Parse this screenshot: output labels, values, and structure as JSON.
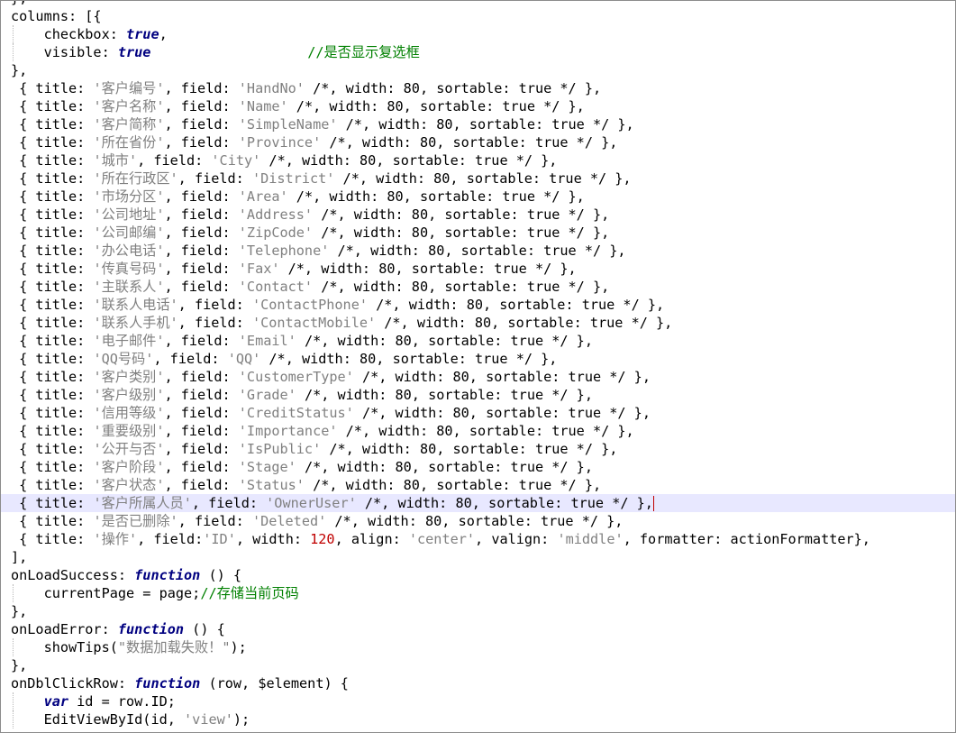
{
  "editor": {
    "lines": [
      {
        "indent": false,
        "hl": false,
        "tokens": [
          {
            "t": "},",
            "c": "pl"
          }
        ]
      },
      {
        "indent": false,
        "hl": false,
        "tokens": [
          {
            "t": "columns: [{",
            "c": "pl"
          }
        ]
      },
      {
        "indent": true,
        "hl": false,
        "tokens": [
          {
            "t": "    checkbox: ",
            "c": "pl"
          },
          {
            "t": "true",
            "c": "kw"
          },
          {
            "t": ",",
            "c": "pl"
          }
        ]
      },
      {
        "indent": true,
        "hl": false,
        "tokens": [
          {
            "t": "    visible: ",
            "c": "pl"
          },
          {
            "t": "true",
            "c": "kw"
          },
          {
            "t": "                   ",
            "c": "pl"
          },
          {
            "t": "//是否显示复选框",
            "c": "cmt"
          }
        ]
      },
      {
        "indent": false,
        "hl": false,
        "tokens": [
          {
            "t": "},",
            "c": "pl"
          }
        ]
      },
      {
        "indent": false,
        "hl": false,
        "tokens": [
          {
            "t": " { title: ",
            "c": "pl"
          },
          {
            "t": "'客户编号'",
            "c": "str"
          },
          {
            "t": ", field: ",
            "c": "pl"
          },
          {
            "t": "'HandNo'",
            "c": "str"
          },
          {
            "t": " /*, width: 80, sortable: true */ },",
            "c": "pl"
          }
        ]
      },
      {
        "indent": false,
        "hl": false,
        "tokens": [
          {
            "t": " { title: ",
            "c": "pl"
          },
          {
            "t": "'客户名称'",
            "c": "str"
          },
          {
            "t": ", field: ",
            "c": "pl"
          },
          {
            "t": "'Name'",
            "c": "str"
          },
          {
            "t": " /*, width: 80, sortable: true */ },",
            "c": "pl"
          }
        ]
      },
      {
        "indent": false,
        "hl": false,
        "tokens": [
          {
            "t": " { title: ",
            "c": "pl"
          },
          {
            "t": "'客户简称'",
            "c": "str"
          },
          {
            "t": ", field: ",
            "c": "pl"
          },
          {
            "t": "'SimpleName'",
            "c": "str"
          },
          {
            "t": " /*, width: 80, sortable: true */ },",
            "c": "pl"
          }
        ]
      },
      {
        "indent": false,
        "hl": false,
        "tokens": [
          {
            "t": " { title: ",
            "c": "pl"
          },
          {
            "t": "'所在省份'",
            "c": "str"
          },
          {
            "t": ", field: ",
            "c": "pl"
          },
          {
            "t": "'Province'",
            "c": "str"
          },
          {
            "t": " /*, width: 80, sortable: true */ },",
            "c": "pl"
          }
        ]
      },
      {
        "indent": false,
        "hl": false,
        "tokens": [
          {
            "t": " { title: ",
            "c": "pl"
          },
          {
            "t": "'城市'",
            "c": "str"
          },
          {
            "t": ", field: ",
            "c": "pl"
          },
          {
            "t": "'City'",
            "c": "str"
          },
          {
            "t": " /*, width: 80, sortable: true */ },",
            "c": "pl"
          }
        ]
      },
      {
        "indent": false,
        "hl": false,
        "tokens": [
          {
            "t": " { title: ",
            "c": "pl"
          },
          {
            "t": "'所在行政区'",
            "c": "str"
          },
          {
            "t": ", field: ",
            "c": "pl"
          },
          {
            "t": "'District'",
            "c": "str"
          },
          {
            "t": " /*, width: 80, sortable: true */ },",
            "c": "pl"
          }
        ]
      },
      {
        "indent": false,
        "hl": false,
        "tokens": [
          {
            "t": " { title: ",
            "c": "pl"
          },
          {
            "t": "'市场分区'",
            "c": "str"
          },
          {
            "t": ", field: ",
            "c": "pl"
          },
          {
            "t": "'Area'",
            "c": "str"
          },
          {
            "t": " /*, width: 80, sortable: true */ },",
            "c": "pl"
          }
        ]
      },
      {
        "indent": false,
        "hl": false,
        "tokens": [
          {
            "t": " { title: ",
            "c": "pl"
          },
          {
            "t": "'公司地址'",
            "c": "str"
          },
          {
            "t": ", field: ",
            "c": "pl"
          },
          {
            "t": "'Address'",
            "c": "str"
          },
          {
            "t": " /*, width: 80, sortable: true */ },",
            "c": "pl"
          }
        ]
      },
      {
        "indent": false,
        "hl": false,
        "tokens": [
          {
            "t": " { title: ",
            "c": "pl"
          },
          {
            "t": "'公司邮编'",
            "c": "str"
          },
          {
            "t": ", field: ",
            "c": "pl"
          },
          {
            "t": "'ZipCode'",
            "c": "str"
          },
          {
            "t": " /*, width: 80, sortable: true */ },",
            "c": "pl"
          }
        ]
      },
      {
        "indent": false,
        "hl": false,
        "tokens": [
          {
            "t": " { title: ",
            "c": "pl"
          },
          {
            "t": "'办公电话'",
            "c": "str"
          },
          {
            "t": ", field: ",
            "c": "pl"
          },
          {
            "t": "'Telephone'",
            "c": "str"
          },
          {
            "t": " /*, width: 80, sortable: true */ },",
            "c": "pl"
          }
        ]
      },
      {
        "indent": false,
        "hl": false,
        "tokens": [
          {
            "t": " { title: ",
            "c": "pl"
          },
          {
            "t": "'传真号码'",
            "c": "str"
          },
          {
            "t": ", field: ",
            "c": "pl"
          },
          {
            "t": "'Fax'",
            "c": "str"
          },
          {
            "t": " /*, width: 80, sortable: true */ },",
            "c": "pl"
          }
        ]
      },
      {
        "indent": false,
        "hl": false,
        "tokens": [
          {
            "t": " { title: ",
            "c": "pl"
          },
          {
            "t": "'主联系人'",
            "c": "str"
          },
          {
            "t": ", field: ",
            "c": "pl"
          },
          {
            "t": "'Contact'",
            "c": "str"
          },
          {
            "t": " /*, width: 80, sortable: true */ },",
            "c": "pl"
          }
        ]
      },
      {
        "indent": false,
        "hl": false,
        "tokens": [
          {
            "t": " { title: ",
            "c": "pl"
          },
          {
            "t": "'联系人电话'",
            "c": "str"
          },
          {
            "t": ", field: ",
            "c": "pl"
          },
          {
            "t": "'ContactPhone'",
            "c": "str"
          },
          {
            "t": " /*, width: 80, sortable: true */ },",
            "c": "pl"
          }
        ]
      },
      {
        "indent": false,
        "hl": false,
        "tokens": [
          {
            "t": " { title: ",
            "c": "pl"
          },
          {
            "t": "'联系人手机'",
            "c": "str"
          },
          {
            "t": ", field: ",
            "c": "pl"
          },
          {
            "t": "'ContactMobile'",
            "c": "str"
          },
          {
            "t": " /*, width: 80, sortable: true */ },",
            "c": "pl"
          }
        ]
      },
      {
        "indent": false,
        "hl": false,
        "tokens": [
          {
            "t": " { title: ",
            "c": "pl"
          },
          {
            "t": "'电子邮件'",
            "c": "str"
          },
          {
            "t": ", field: ",
            "c": "pl"
          },
          {
            "t": "'Email'",
            "c": "str"
          },
          {
            "t": " /*, width: 80, sortable: true */ },",
            "c": "pl"
          }
        ]
      },
      {
        "indent": false,
        "hl": false,
        "tokens": [
          {
            "t": " { title: ",
            "c": "pl"
          },
          {
            "t": "'QQ号码'",
            "c": "str"
          },
          {
            "t": ", field: ",
            "c": "pl"
          },
          {
            "t": "'QQ'",
            "c": "str"
          },
          {
            "t": " /*, width: 80, sortable: true */ },",
            "c": "pl"
          }
        ]
      },
      {
        "indent": false,
        "hl": false,
        "tokens": [
          {
            "t": " { title: ",
            "c": "pl"
          },
          {
            "t": "'客户类别'",
            "c": "str"
          },
          {
            "t": ", field: ",
            "c": "pl"
          },
          {
            "t": "'CustomerType'",
            "c": "str"
          },
          {
            "t": " /*, width: 80, sortable: true */ },",
            "c": "pl"
          }
        ]
      },
      {
        "indent": false,
        "hl": false,
        "tokens": [
          {
            "t": " { title: ",
            "c": "pl"
          },
          {
            "t": "'客户级别'",
            "c": "str"
          },
          {
            "t": ", field: ",
            "c": "pl"
          },
          {
            "t": "'Grade'",
            "c": "str"
          },
          {
            "t": " /*, width: 80, sortable: true */ },",
            "c": "pl"
          }
        ]
      },
      {
        "indent": false,
        "hl": false,
        "tokens": [
          {
            "t": " { title: ",
            "c": "pl"
          },
          {
            "t": "'信用等级'",
            "c": "str"
          },
          {
            "t": ", field: ",
            "c": "pl"
          },
          {
            "t": "'CreditStatus'",
            "c": "str"
          },
          {
            "t": " /*, width: 80, sortable: true */ },",
            "c": "pl"
          }
        ]
      },
      {
        "indent": false,
        "hl": false,
        "tokens": [
          {
            "t": " { title: ",
            "c": "pl"
          },
          {
            "t": "'重要级别'",
            "c": "str"
          },
          {
            "t": ", field: ",
            "c": "pl"
          },
          {
            "t": "'Importance'",
            "c": "str"
          },
          {
            "t": " /*, width: 80, sortable: true */ },",
            "c": "pl"
          }
        ]
      },
      {
        "indent": false,
        "hl": false,
        "tokens": [
          {
            "t": " { title: ",
            "c": "pl"
          },
          {
            "t": "'公开与否'",
            "c": "str"
          },
          {
            "t": ", field: ",
            "c": "pl"
          },
          {
            "t": "'IsPublic'",
            "c": "str"
          },
          {
            "t": " /*, width: 80, sortable: true */ },",
            "c": "pl"
          }
        ]
      },
      {
        "indent": false,
        "hl": false,
        "tokens": [
          {
            "t": " { title: ",
            "c": "pl"
          },
          {
            "t": "'客户阶段'",
            "c": "str"
          },
          {
            "t": ", field: ",
            "c": "pl"
          },
          {
            "t": "'Stage'",
            "c": "str"
          },
          {
            "t": " /*, width: 80, sortable: true */ },",
            "c": "pl"
          }
        ]
      },
      {
        "indent": false,
        "hl": false,
        "tokens": [
          {
            "t": " { title: ",
            "c": "pl"
          },
          {
            "t": "'客户状态'",
            "c": "str"
          },
          {
            "t": ", field: ",
            "c": "pl"
          },
          {
            "t": "'Status'",
            "c": "str"
          },
          {
            "t": " /*, width: 80, sortable: true */ },",
            "c": "pl"
          }
        ]
      },
      {
        "indent": false,
        "hl": true,
        "caret": true,
        "tokens": [
          {
            "t": " { title: ",
            "c": "pl"
          },
          {
            "t": "'客户所属人员'",
            "c": "str"
          },
          {
            "t": ", field: ",
            "c": "pl"
          },
          {
            "t": "'OwnerUser'",
            "c": "str"
          },
          {
            "t": " /*, width: 80, sortable: true */ },",
            "c": "pl"
          }
        ]
      },
      {
        "indent": false,
        "hl": false,
        "tokens": [
          {
            "t": " { title: ",
            "c": "pl"
          },
          {
            "t": "'是否已删除'",
            "c": "str"
          },
          {
            "t": ", field: ",
            "c": "pl"
          },
          {
            "t": "'Deleted'",
            "c": "str"
          },
          {
            "t": " /*, width: 80, sortable: true */ },",
            "c": "pl"
          }
        ]
      },
      {
        "indent": false,
        "hl": false,
        "tokens": [
          {
            "t": " { title: ",
            "c": "pl"
          },
          {
            "t": "'操作'",
            "c": "str"
          },
          {
            "t": ", field:",
            "c": "pl"
          },
          {
            "t": "'ID'",
            "c": "str"
          },
          {
            "t": ", width: ",
            "c": "pl"
          },
          {
            "t": "120",
            "c": "num"
          },
          {
            "t": ", align: ",
            "c": "pl"
          },
          {
            "t": "'center'",
            "c": "str"
          },
          {
            "t": ", valign: ",
            "c": "pl"
          },
          {
            "t": "'middle'",
            "c": "str"
          },
          {
            "t": ", formatter: actionFormatter},",
            "c": "pl"
          }
        ]
      },
      {
        "indent": false,
        "hl": false,
        "tokens": [
          {
            "t": "],",
            "c": "pl"
          }
        ]
      },
      {
        "indent": false,
        "hl": false,
        "tokens": [
          {
            "t": "onLoadSuccess: ",
            "c": "pl"
          },
          {
            "t": "function",
            "c": "kw"
          },
          {
            "t": " () {",
            "c": "pl"
          }
        ]
      },
      {
        "indent": true,
        "hl": false,
        "tokens": [
          {
            "t": "    currentPage = page;",
            "c": "pl"
          },
          {
            "t": "//存储当前页码",
            "c": "cmt"
          }
        ]
      },
      {
        "indent": false,
        "hl": false,
        "tokens": [
          {
            "t": "},",
            "c": "pl"
          }
        ]
      },
      {
        "indent": false,
        "hl": false,
        "tokens": [
          {
            "t": "onLoadError: ",
            "c": "pl"
          },
          {
            "t": "function",
            "c": "kw"
          },
          {
            "t": " () {",
            "c": "pl"
          }
        ]
      },
      {
        "indent": true,
        "hl": false,
        "tokens": [
          {
            "t": "    showTips(",
            "c": "pl"
          },
          {
            "t": "\"数据加载失败！\"",
            "c": "str"
          },
          {
            "t": ");",
            "c": "pl"
          }
        ]
      },
      {
        "indent": false,
        "hl": false,
        "tokens": [
          {
            "t": "},",
            "c": "pl"
          }
        ]
      },
      {
        "indent": false,
        "hl": false,
        "tokens": [
          {
            "t": "onDblClickRow: ",
            "c": "pl"
          },
          {
            "t": "function",
            "c": "kw"
          },
          {
            "t": " (row, $element) {",
            "c": "pl"
          }
        ]
      },
      {
        "indent": true,
        "hl": false,
        "tokens": [
          {
            "t": "    ",
            "c": "pl"
          },
          {
            "t": "var",
            "c": "kw"
          },
          {
            "t": " id = row.ID;",
            "c": "pl"
          }
        ]
      },
      {
        "indent": true,
        "hl": false,
        "tokens": [
          {
            "t": "    EditViewById(id, ",
            "c": "pl"
          },
          {
            "t": "'view'",
            "c": "str"
          },
          {
            "t": ");",
            "c": "pl"
          }
        ]
      }
    ]
  }
}
